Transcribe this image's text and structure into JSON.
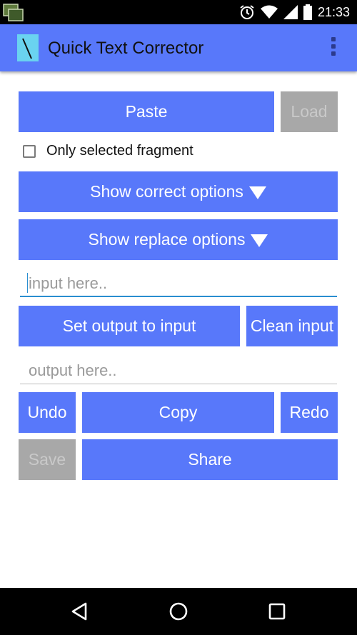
{
  "status_bar": {
    "time": "21:33",
    "icons": [
      "app-notification-icon",
      "alarm-icon",
      "wifi-icon",
      "signal-icon",
      "battery-icon"
    ]
  },
  "app_bar": {
    "title": "Quick Text Corrector",
    "logo_icon": "app-logo-icon",
    "menu_icon": "overflow-menu-icon"
  },
  "controls": {
    "paste_label": "Paste",
    "load_label": "Load",
    "only_selected_label": "Only selected fragment",
    "only_selected_checked": false,
    "show_correct_label": "Show correct options",
    "show_replace_label": "Show replace options",
    "input_placeholder": "input here..",
    "input_value": "",
    "set_output_label": "Set output to input",
    "clean_input_label": "Clean input",
    "output_placeholder": "output here..",
    "output_value": "",
    "undo_label": "Undo",
    "copy_label": "Copy",
    "redo_label": "Redo",
    "save_label": "Save",
    "share_label": "Share"
  },
  "nav_bar": {
    "icons": [
      "back-icon",
      "home-icon",
      "recents-icon"
    ]
  },
  "colors": {
    "accent": "#5878fa",
    "disabled": "#a8a8a8",
    "focus": "#2a8ed0"
  }
}
